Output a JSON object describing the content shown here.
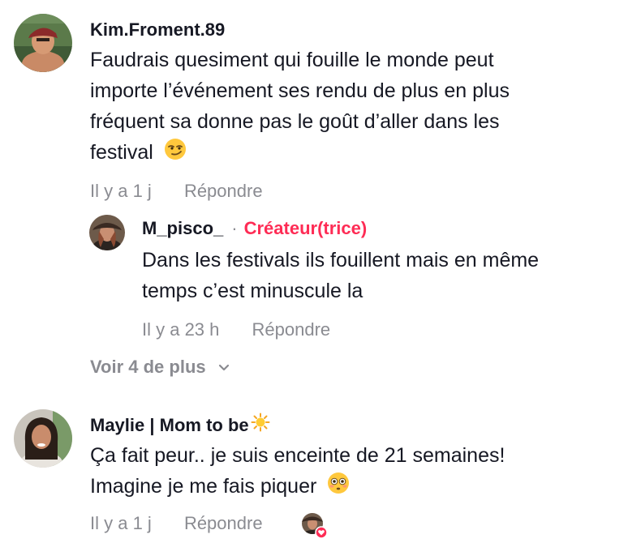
{
  "comments": [
    {
      "username": "Kim.Froment.89",
      "text_lines": [
        "Faudrais quesiment qui fouille le monde peut",
        "importe l’événement ses rendu de plus en plus",
        "fréquent sa donne pas le goût d’aller dans les",
        "festival"
      ],
      "emoji": "smirk-emoji",
      "time": "Il y a 1 j",
      "reply_label": "Répondre",
      "replies": [
        {
          "username": "M_pisco_",
          "separator": "·",
          "badge": "Créateur(trice)",
          "text_lines": [
            "Dans les festivals ils fouillent mais en même",
            "temps c’est minuscule la"
          ],
          "time": "Il y a 23 h",
          "reply_label": "Répondre"
        }
      ],
      "see_more_label": "Voir 4 de plus"
    },
    {
      "username": "Maylie | Mom to be",
      "username_emoji": "sun-emoji",
      "text_lines": [
        "Ça fait peur.. je suis enceinte de 21 semaines!",
        "Imagine je me fais piquer"
      ],
      "emoji": "flushed-emoji",
      "time": "Il y a 1 j",
      "reply_label": "Répondre",
      "liked_by_creator": true
    }
  ],
  "colors": {
    "text": "#161823",
    "secondary": "#8a8b91",
    "creator_accent": "#fe2c55"
  }
}
